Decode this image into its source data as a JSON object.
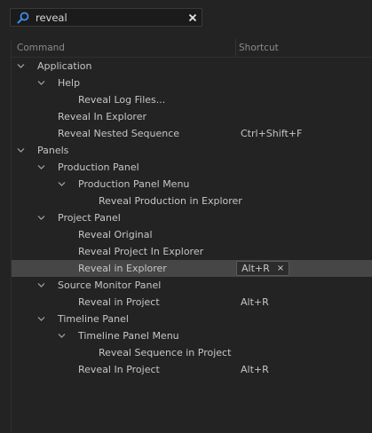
{
  "search": {
    "value": "reveal",
    "placeholder": ""
  },
  "columns": {
    "command": "Command",
    "shortcut": "Shortcut"
  },
  "rows": [
    {
      "label": "Application",
      "level": 0,
      "expandable": true,
      "shortcut": ""
    },
    {
      "label": "Help",
      "level": 1,
      "expandable": true,
      "shortcut": ""
    },
    {
      "label": "Reveal Log Files...",
      "level": 2,
      "expandable": false,
      "shortcut": ""
    },
    {
      "label": "Reveal In Explorer",
      "level": 1,
      "expandable": false,
      "shortcut": ""
    },
    {
      "label": "Reveal Nested Sequence",
      "level": 1,
      "expandable": false,
      "shortcut": "Ctrl+Shift+F"
    },
    {
      "label": "Panels",
      "level": 0,
      "expandable": true,
      "shortcut": ""
    },
    {
      "label": "Production Panel",
      "level": 1,
      "expandable": true,
      "shortcut": ""
    },
    {
      "label": "Production Panel Menu",
      "level": 2,
      "expandable": true,
      "shortcut": ""
    },
    {
      "label": "Reveal Production in Explorer",
      "level": 3,
      "expandable": false,
      "shortcut": ""
    },
    {
      "label": "Project Panel",
      "level": 1,
      "expandable": true,
      "shortcut": ""
    },
    {
      "label": "Reveal Original",
      "level": 2,
      "expandable": false,
      "shortcut": ""
    },
    {
      "label": "Reveal Project In Explorer",
      "level": 2,
      "expandable": false,
      "shortcut": ""
    },
    {
      "label": "Reveal in Explorer",
      "level": 2,
      "expandable": false,
      "shortcut": "Alt+R",
      "selected": true,
      "editing": true
    },
    {
      "label": "Source Monitor Panel",
      "level": 1,
      "expandable": true,
      "shortcut": ""
    },
    {
      "label": "Reveal in Project",
      "level": 2,
      "expandable": false,
      "shortcut": "Alt+R"
    },
    {
      "label": "Timeline Panel",
      "level": 1,
      "expandable": true,
      "shortcut": ""
    },
    {
      "label": "Timeline Panel Menu",
      "level": 2,
      "expandable": true,
      "shortcut": ""
    },
    {
      "label": "Reveal Sequence in Project",
      "level": 3,
      "expandable": false,
      "shortcut": ""
    },
    {
      "label": "Reveal In Project",
      "level": 2,
      "expandable": false,
      "shortcut": "Alt+R"
    }
  ],
  "colors": {
    "background": "#232323",
    "selected_row": "#464646",
    "search_icon": "#3d8ee8",
    "text": "#c6c6c6",
    "header_text": "#8b8b8b"
  },
  "icons": {
    "search": "search-icon",
    "clear": "close-icon",
    "expand": "chevron-down-icon",
    "remove_shortcut": "close-icon"
  }
}
